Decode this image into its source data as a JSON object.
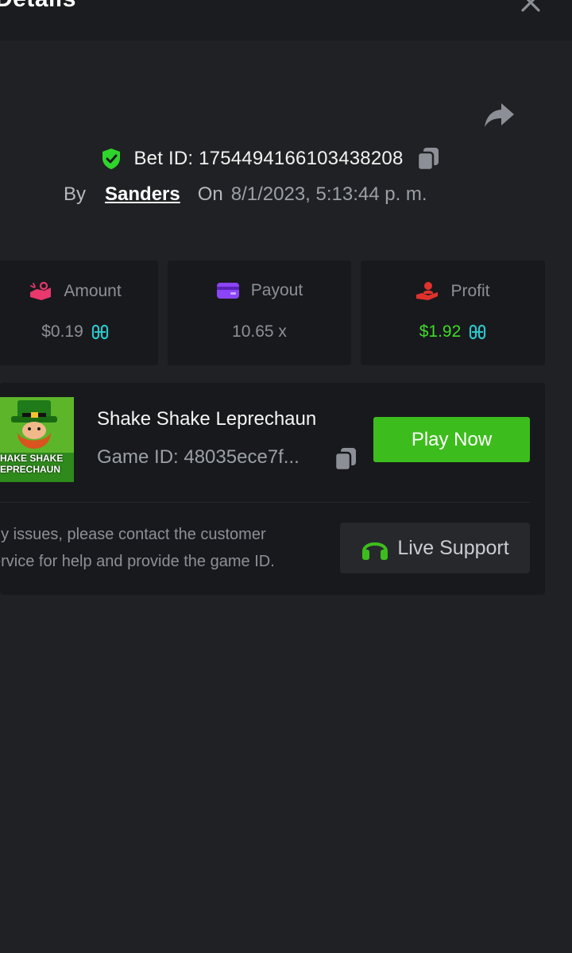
{
  "header": {
    "title": "Details",
    "close_icon": "close-icon"
  },
  "bet": {
    "id_text": "Bet ID: 1754494166103438208",
    "by_label": "By",
    "author": "Sanders",
    "on_label": "On",
    "timestamp": "8/1/2023, 5:13:44 p. m."
  },
  "stats": {
    "amount": {
      "label": "Amount",
      "value": "$0.19",
      "icon": "money-hand-icon",
      "color": "#e8386d"
    },
    "payout": {
      "label": "Payout",
      "value": "10.65 x",
      "icon": "card-icon",
      "color": "#8b44f7"
    },
    "profit": {
      "label": "Profit",
      "value": "$1.92",
      "icon": "user-hand-icon",
      "color": "#e0322c",
      "value_color": "#3ddc28"
    }
  },
  "game": {
    "name": "Shake Shake Leprechaun",
    "id_text": "Game ID: 48035ece7f...",
    "thumb_text_1": "HAKE SHAKE",
    "thumb_text_2": "EPRECHAUN",
    "play_label": "Play Now",
    "help_line_1": "ny issues, please contact the customer",
    "help_line_2": "ervice for help and provide the game ID.",
    "support_label": "Live Support"
  },
  "colors": {
    "accent": "#3dbd1d",
    "coin": "#2fc4c8",
    "shield": "#2ed52b"
  }
}
